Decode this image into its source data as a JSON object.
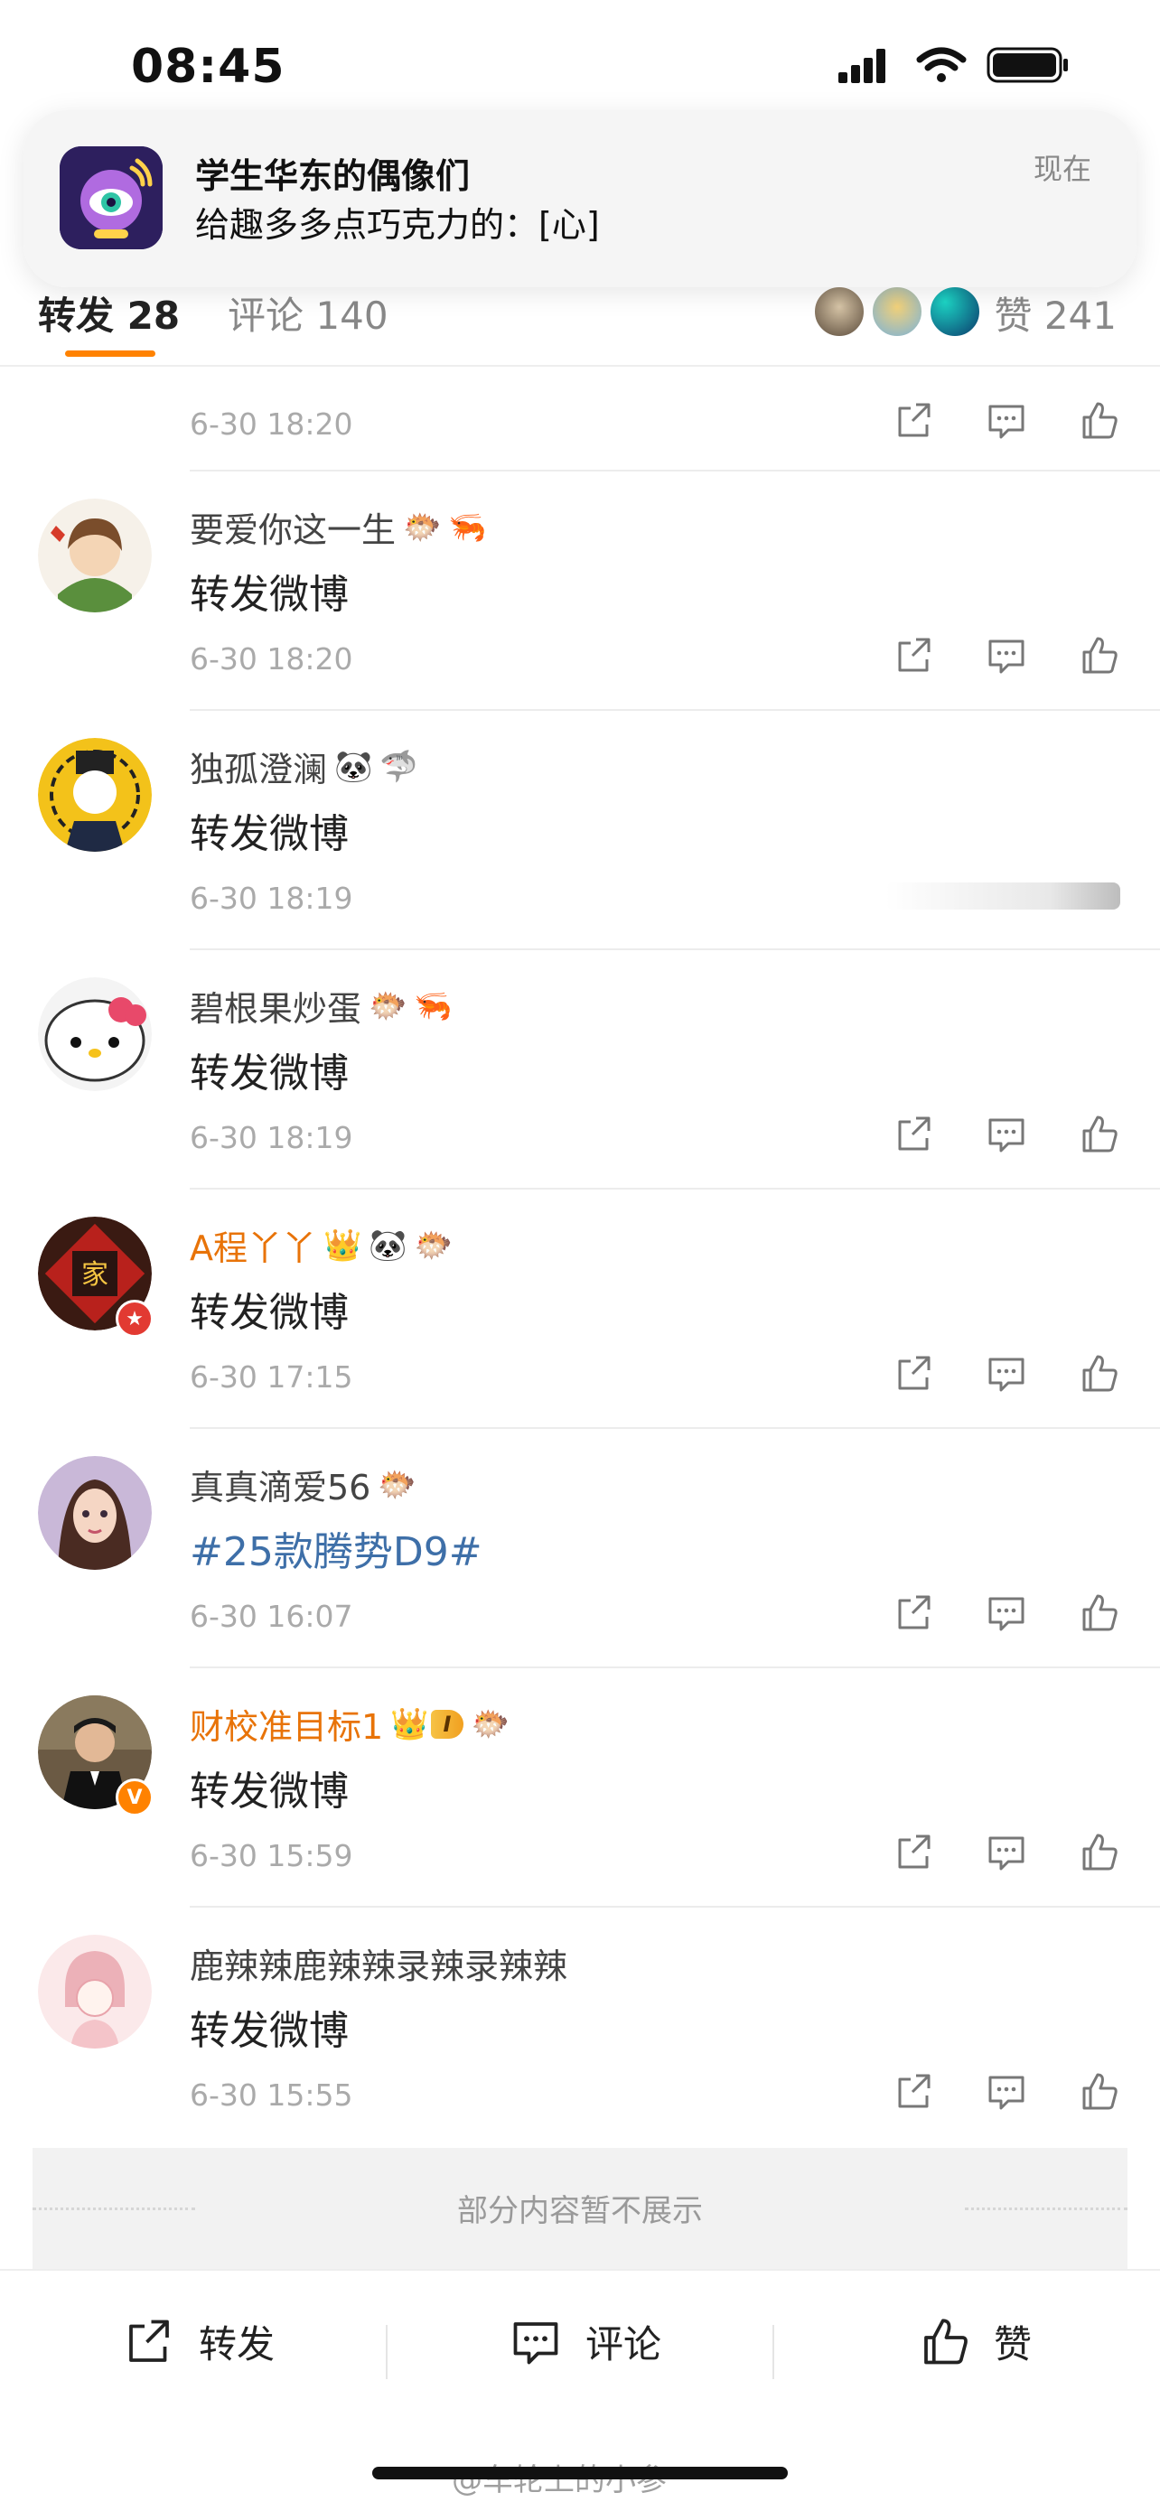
{
  "status_bar": {
    "time": "08:45"
  },
  "notification": {
    "app_title": "学生华东的偶像们",
    "message": "给趣多多点巧克力的：[心]",
    "time": "现在"
  },
  "tabs": {
    "repost_label": "转发",
    "repost_count": "28",
    "comment_label": "评论",
    "comment_count": "140",
    "like_label": "赞",
    "like_count": "241"
  },
  "partial_row": {
    "time": "6-30 18:20"
  },
  "reposts": [
    {
      "user": "要爱你这一生",
      "text": "转发微博",
      "time": "6-30 18:20"
    },
    {
      "user": "独孤澄澜",
      "text": "转发微博",
      "time": "6-30 18:19"
    },
    {
      "user": "碧根果炒蛋",
      "text": "转发微博",
      "time": "6-30 18:19"
    },
    {
      "user": "A程丫丫",
      "text": "转发微博",
      "time": "6-30 17:15"
    },
    {
      "user": "真真滴爱56",
      "text": "#25款腾势D9#",
      "time": "6-30 16:07"
    },
    {
      "user": "财校准目标1",
      "text": "转发微博",
      "time": "6-30 15:59"
    },
    {
      "user": "鹿辣辣鹿辣辣录辣录辣辣",
      "text": "转发微博",
      "time": "6-30 15:55"
    }
  ],
  "vip_badge_label": "I",
  "hidden_notice": "部分内容暂不展示",
  "bottom_bar": {
    "repost": "转发",
    "comment": "评论",
    "like": "赞"
  },
  "watermark": "@车轮上的小参",
  "colors": {
    "accent": "#ff8200",
    "vip_name": "#e87308",
    "topic": "#3e6fa8"
  }
}
